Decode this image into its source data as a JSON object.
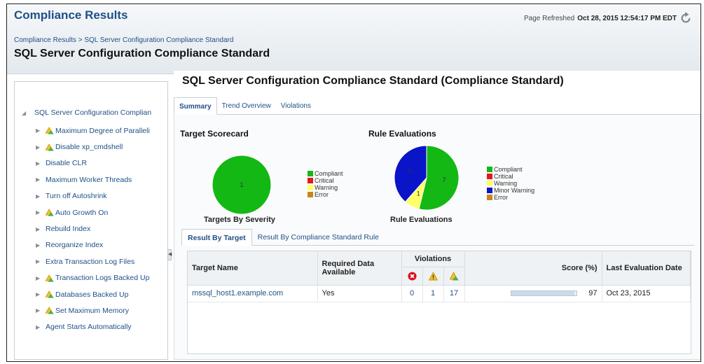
{
  "header": {
    "title": "Compliance Results",
    "refresh_prefix": "Page Refreshed",
    "refresh_time": "Oct 28, 2015 12:54:17 PM EDT",
    "breadcrumb_root": "Compliance Results",
    "breadcrumb_sep": ">",
    "breadcrumb_current": "SQL Server Configuration Compliance Standard",
    "subtitle": "SQL Server Configuration Compliance Standard"
  },
  "tree": {
    "root_label": "SQL Server Configuration Complian",
    "items": [
      {
        "label": "Maximum Degree of Paralleli",
        "warning": true
      },
      {
        "label": "Disable xp_cmdshell",
        "warning": true
      },
      {
        "label": "Disable CLR",
        "warning": false
      },
      {
        "label": "Maximum Worker Threads",
        "warning": false
      },
      {
        "label": "Turn off Autoshrink",
        "warning": false
      },
      {
        "label": "Auto Growth On",
        "warning": true
      },
      {
        "label": "Rebuild Index",
        "warning": false
      },
      {
        "label": "Reorganize Index",
        "warning": false
      },
      {
        "label": "Extra Transaction Log Files",
        "warning": false
      },
      {
        "label": "Transaction Logs Backed Up",
        "warning": true
      },
      {
        "label": "Databases Backed Up",
        "warning": true
      },
      {
        "label": "Set Maximum Memory",
        "warning": true
      },
      {
        "label": "Agent Starts Automatically",
        "warning": false
      }
    ]
  },
  "main": {
    "title": "SQL Server Configuration Compliance Standard (Compliance Standard)",
    "tabs": [
      "Summary",
      "Trend Overview",
      "Violations"
    ],
    "scorecard_heading": "Target Scorecard",
    "rules_heading": "Rule Evaluations"
  },
  "colors": {
    "compliant": "#14b814",
    "critical": "#e8141e",
    "warning": "#ffff66",
    "minor_warning": "#0a14c8",
    "error": "#c8861e"
  },
  "chart_data": [
    {
      "type": "pie",
      "title": "Targets By Severity",
      "slices": [
        {
          "label": "",
          "value": 1
        }
      ],
      "slice_colors": [
        "#14b814"
      ],
      "legend": [
        "Compliant",
        "Critical",
        "Warning",
        "Error"
      ],
      "legend_colors": [
        "#14b814",
        "#e8141e",
        "#ffff66",
        "#c8861e"
      ],
      "legend_position": "right"
    },
    {
      "type": "pie",
      "title": "Rule Evaluations",
      "slices": [
        {
          "label": "",
          "value": 7
        },
        {
          "label": "",
          "value": 1
        },
        {
          "label": "",
          "value": 5
        }
      ],
      "slice_colors": [
        "#14b814",
        "#ffff66",
        "#0a14c8"
      ],
      "legend": [
        "Compliant",
        "Critical",
        "Warning",
        "Minor Warning",
        "Error"
      ],
      "legend_colors": [
        "#14b814",
        "#e8141e",
        "#ffff66",
        "#0a14c8",
        "#c8861e"
      ],
      "legend_position": "right"
    }
  ],
  "results": {
    "subtabs": [
      "Result By Target",
      "Result By Compliance Standard Rule"
    ],
    "columns": {
      "target": "Target Name",
      "required": "Required Data Available",
      "violations": "Violations",
      "score": "Score (%)",
      "last_eval": "Last Evaluation Date"
    },
    "rows": [
      {
        "target": "mssql_host1.example.com",
        "required": "Yes",
        "critical": "0",
        "warning": "1",
        "minor": "17",
        "score": "97",
        "score_fraction": 0.97,
        "last_eval": "Oct 23, 2015"
      }
    ]
  }
}
